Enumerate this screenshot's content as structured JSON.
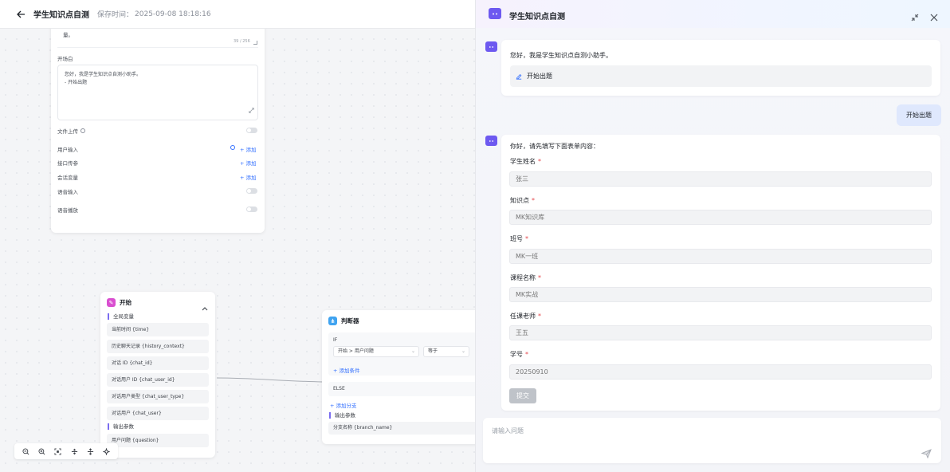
{
  "header": {
    "title": "学生知识点自测",
    "save_label": "保存时间：",
    "save_time": "2025-09-08 18:18:16"
  },
  "config_panel": {
    "top_text": "量。",
    "counter": "39 / 256",
    "opening_label": "开场白",
    "opening_line1": "您好，我是学生知识点自测小助手。",
    "opening_line2": "- 开始出题",
    "file_upload": "文件上传",
    "user_input": "用户输入",
    "api_params": "接口传参",
    "session_vars": "会话变量",
    "voice_input": "语音输入",
    "voice_play": "语音播放",
    "add": "+ 添加"
  },
  "start_node": {
    "title": "开始",
    "global_vars": "全局变量",
    "fields": [
      "当前时间 {time}",
      "历史聊天记录 {history_context}",
      "对话 ID {chat_id}",
      "对话用户 ID {chat_user_id}",
      "对话用户类型 {chat_user_type}",
      "对话用户 {chat_user}"
    ],
    "output_label": "输出参数",
    "output_field": "用户问题 {question}"
  },
  "judge_node": {
    "title": "判断器",
    "if_label": "IF",
    "condition_select": "开始 > 用户问题",
    "operator_select": "等于",
    "add_condition": "+ 添加条件",
    "else_label": "ELSE",
    "add_branch": "+ 添加分支",
    "output_label": "输出参数",
    "output_field": "分支名称 {branch_name}"
  },
  "chat": {
    "title": "学生知识点自测",
    "greeting": "您好，我是学生知识点自测小助手。",
    "quick_action": "开始出题",
    "user_message": "开始出题",
    "form_intro": "你好，请先填写下面表单内容：",
    "fields": [
      {
        "label": "学生姓名",
        "placeholder": "张三"
      },
      {
        "label": "知识点",
        "placeholder": "MK知识库"
      },
      {
        "label": "班号",
        "placeholder": "MK一班"
      },
      {
        "label": "课程名称",
        "placeholder": "MK实战"
      },
      {
        "label": "任课老师",
        "placeholder": "王五"
      },
      {
        "label": "学号",
        "placeholder": "20250910"
      }
    ],
    "required_mark": "*",
    "submit": "提交",
    "input_placeholder": "请输入问题"
  },
  "colors": {
    "accent": "#3370ff",
    "brand": "#6d59f0",
    "start_icon": "#d94fd0",
    "judge_icon": "#3fa3f0"
  },
  "icons": [
    "back-arrow-icon",
    "bot-icon",
    "minimize-icon",
    "close-icon",
    "send-icon",
    "edit-icon",
    "zoom-out-icon",
    "zoom-in-icon",
    "fit-view-icon",
    "info-icon",
    "settings-icon"
  ]
}
